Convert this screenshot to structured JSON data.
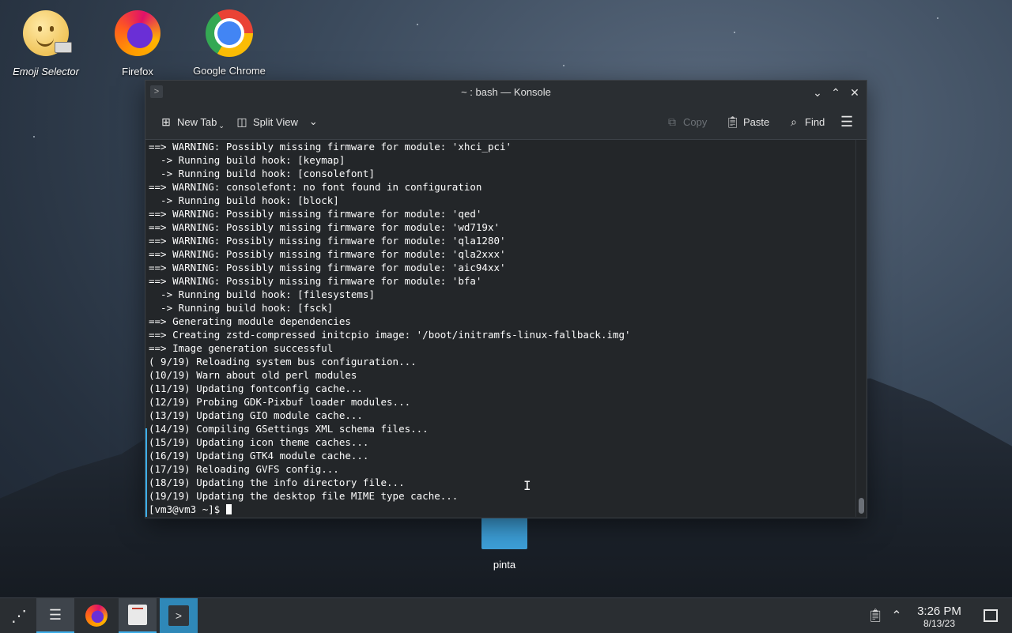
{
  "desktop": {
    "icons": [
      {
        "label": "Emoji Selector"
      },
      {
        "label": "Firefox"
      },
      {
        "label": "Google Chrome"
      },
      {
        "label": "pinta"
      }
    ]
  },
  "window": {
    "title": "~ : bash — Konsole",
    "toolbar": {
      "new_tab": "New Tab",
      "split_view": "Split View",
      "copy": "Copy",
      "paste": "Paste",
      "find": "Find"
    }
  },
  "terminal": {
    "lines": [
      "==> WARNING: Possibly missing firmware for module: 'xhci_pci'",
      "  -> Running build hook: [keymap]",
      "  -> Running build hook: [consolefont]",
      "==> WARNING: consolefont: no font found in configuration",
      "  -> Running build hook: [block]",
      "==> WARNING: Possibly missing firmware for module: 'qed'",
      "==> WARNING: Possibly missing firmware for module: 'wd719x'",
      "==> WARNING: Possibly missing firmware for module: 'qla1280'",
      "==> WARNING: Possibly missing firmware for module: 'qla2xxx'",
      "==> WARNING: Possibly missing firmware for module: 'aic94xx'",
      "==> WARNING: Possibly missing firmware for module: 'bfa'",
      "  -> Running build hook: [filesystems]",
      "  -> Running build hook: [fsck]",
      "==> Generating module dependencies",
      "==> Creating zstd-compressed initcpio image: '/boot/initramfs-linux-fallback.img'",
      "==> Image generation successful",
      "( 9/19) Reloading system bus configuration...",
      "(10/19) Warn about old perl modules",
      "(11/19) Updating fontconfig cache...",
      "(12/19) Probing GDK-Pixbuf loader modules...",
      "(13/19) Updating GIO module cache...",
      "(14/19) Compiling GSettings XML schema files...",
      "(15/19) Updating icon theme caches...",
      "(16/19) Updating GTK4 module cache...",
      "(17/19) Reloading GVFS config...",
      "(18/19) Updating the info directory file...",
      "(19/19) Updating the desktop file MIME type cache..."
    ],
    "prompt": "[vm3@vm3 ~]$ "
  },
  "taskbar": {
    "time": "3:26 PM",
    "date": "8/13/23"
  }
}
